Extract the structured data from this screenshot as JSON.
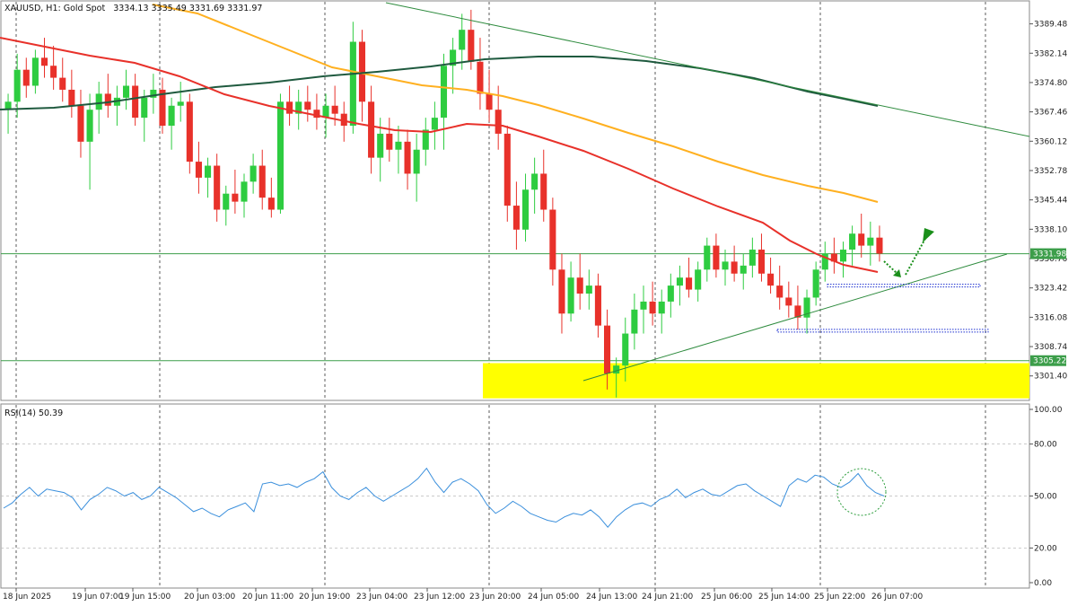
{
  "header": {
    "symbol": "XAUUSD, H1:  Gold Spot",
    "ohlc": "3334.13 3335.49 3331.69 3331.97"
  },
  "rsi": {
    "label": "RSI(14) 50.39",
    "levels": [
      100,
      80,
      50,
      20,
      0
    ],
    "level_labels": [
      "100.00",
      "80.00",
      "50.00",
      "20.00",
      "0.00"
    ]
  },
  "colors": {
    "bull": "#26a69a",
    "bear": "#ef3b2c",
    "bull_candle": "#2ecc40",
    "bear_candle": "#e8312a",
    "ma_fast": "#e8312a",
    "ma_mid": "#ffb020",
    "ma_slow": "#1f5a3f",
    "trend": "#2e8b3e",
    "zone": "#ffff00",
    "rsi_line": "#3a8fdc",
    "level_dotted": "#1b2fd0",
    "arrow": "#1a8f1a"
  },
  "chart_data": {
    "type": "candlestick",
    "title": "XAUUSD, H1:  Gold Spot",
    "ylim": [
      3295.5,
      3395.0
    ],
    "price_ticks": [
      "3389.48",
      "3382.14",
      "3374.80",
      "3367.46",
      "3360.12",
      "3352.78",
      "3345.44",
      "3338.10",
      "3330.76",
      "3323.42",
      "3316.08",
      "3308.74",
      "3301.40"
    ],
    "x_labels": [
      "18 Jun 2025",
      "19 Jun 07:00",
      "19 Jun 15:00",
      "20 Jun 03:00",
      "20 Jun 11:00",
      "20 Jun 19:00",
      "23 Jun 04:00",
      "23 Jun 12:00",
      "23 Jun 20:00",
      "24 Jun 05:00",
      "24 Jun 13:00",
      "24 Jun 21:00",
      "25 Jun 06:00",
      "25 Jun 14:00",
      "25 Jun 22:00",
      "26 Jun 07:00"
    ],
    "current_price": "3331.98",
    "support_price": "3305.22",
    "horizontal_lines": [
      3331.98,
      3305.22
    ],
    "zone": [
      3295.8,
      3304.6
    ],
    "dotted_levels": [
      3324.0,
      3312.7
    ],
    "candles": [
      [
        3368,
        3372,
        3362,
        3370
      ],
      [
        3370,
        3382,
        3366,
        3378
      ],
      [
        3378,
        3381,
        3371,
        3374
      ],
      [
        3374,
        3383,
        3372,
        3381
      ],
      [
        3381,
        3386,
        3376,
        3379
      ],
      [
        3379,
        3384,
        3373,
        3376
      ],
      [
        3376,
        3381,
        3370,
        3373
      ],
      [
        3373,
        3378,
        3366,
        3369
      ],
      [
        3369,
        3373,
        3356,
        3360
      ],
      [
        3360,
        3372,
        3348,
        3368
      ],
      [
        3368,
        3375,
        3362,
        3372
      ],
      [
        3372,
        3377,
        3366,
        3369
      ],
      [
        3369,
        3374,
        3364,
        3371
      ],
      [
        3371,
        3378,
        3368,
        3374
      ],
      [
        3374,
        3377,
        3364,
        3366
      ],
      [
        3366,
        3373,
        3360,
        3371
      ],
      [
        3371,
        3377,
        3367,
        3373
      ],
      [
        3373,
        3376,
        3362,
        3364
      ],
      [
        3364,
        3371,
        3358,
        3369
      ],
      [
        3369,
        3375,
        3365,
        3370
      ],
      [
        3370,
        3372,
        3352,
        3355
      ],
      [
        3355,
        3360,
        3347,
        3351
      ],
      [
        3351,
        3356,
        3346,
        3354
      ],
      [
        3354,
        3357,
        3340,
        3343
      ],
      [
        3343,
        3349,
        3339,
        3347
      ],
      [
        3347,
        3353,
        3342,
        3345
      ],
      [
        3345,
        3352,
        3341,
        3350
      ],
      [
        3350,
        3357,
        3347,
        3354
      ],
      [
        3354,
        3358,
        3343,
        3346
      ],
      [
        3346,
        3351,
        3341,
        3343
      ],
      [
        3343,
        3372,
        3342,
        3370
      ],
      [
        3370,
        3374,
        3364,
        3367
      ],
      [
        3367,
        3373,
        3363,
        3370
      ],
      [
        3370,
        3374,
        3365,
        3368
      ],
      [
        3368,
        3372,
        3363,
        3366
      ],
      [
        3366,
        3372,
        3361,
        3369
      ],
      [
        3369,
        3374,
        3364,
        3367
      ],
      [
        3367,
        3370,
        3360,
        3364
      ],
      [
        3364,
        3390,
        3362,
        3385
      ],
      [
        3385,
        3388,
        3365,
        3370
      ],
      [
        3370,
        3374,
        3352,
        3356
      ],
      [
        3356,
        3366,
        3350,
        3362
      ],
      [
        3362,
        3366,
        3355,
        3358
      ],
      [
        3358,
        3364,
        3352,
        3360
      ],
      [
        3360,
        3363,
        3348,
        3352
      ],
      [
        3352,
        3362,
        3345,
        3358
      ],
      [
        3358,
        3366,
        3354,
        3363
      ],
      [
        3363,
        3370,
        3358,
        3366
      ],
      [
        3366,
        3382,
        3358,
        3379
      ],
      [
        3379,
        3386,
        3372,
        3383
      ],
      [
        3383,
        3392,
        3378,
        3388
      ],
      [
        3388,
        3393,
        3378,
        3380
      ],
      [
        3380,
        3386,
        3368,
        3372
      ],
      [
        3372,
        3378,
        3365,
        3368
      ],
      [
        3368,
        3374,
        3358,
        3362
      ],
      [
        3362,
        3364,
        3340,
        3344
      ],
      [
        3344,
        3350,
        3333,
        3338
      ],
      [
        3338,
        3352,
        3335,
        3348
      ],
      [
        3348,
        3356,
        3342,
        3352
      ],
      [
        3352,
        3358,
        3340,
        3343
      ],
      [
        3343,
        3346,
        3324,
        3328
      ],
      [
        3328,
        3332,
        3312,
        3317
      ],
      [
        3317,
        3330,
        3315,
        3326
      ],
      [
        3326,
        3332,
        3318,
        3322
      ],
      [
        3322,
        3328,
        3318,
        3324
      ],
      [
        3324,
        3327,
        3311,
        3314
      ],
      [
        3314,
        3318,
        3298,
        3302
      ],
      [
        3302,
        3306,
        3296,
        3304
      ],
      [
        3304,
        3316,
        3300,
        3312
      ],
      [
        3312,
        3322,
        3308,
        3318
      ],
      [
        3318,
        3324,
        3312,
        3320
      ],
      [
        3320,
        3325,
        3314,
        3317
      ],
      [
        3317,
        3323,
        3312,
        3320
      ],
      [
        3320,
        3327,
        3316,
        3324
      ],
      [
        3324,
        3329,
        3319,
        3326
      ],
      [
        3326,
        3331,
        3321,
        3323
      ],
      [
        3323,
        3330,
        3320,
        3328
      ],
      [
        3328,
        3336,
        3325,
        3334
      ],
      [
        3334,
        3337,
        3326,
        3328
      ],
      [
        3328,
        3333,
        3324,
        3330
      ],
      [
        3330,
        3334,
        3325,
        3327
      ],
      [
        3327,
        3332,
        3323,
        3329
      ],
      [
        3329,
        3336,
        3326,
        3333
      ],
      [
        3333,
        3337,
        3325,
        3327
      ],
      [
        3327,
        3331,
        3322,
        3324
      ],
      [
        3324,
        3329,
        3318,
        3321
      ],
      [
        3321,
        3325,
        3316,
        3319
      ],
      [
        3319,
        3324,
        3313,
        3316
      ],
      [
        3316,
        3323,
        3312,
        3321
      ],
      [
        3321,
        3330,
        3319,
        3328
      ],
      [
        3328,
        3335,
        3325,
        3332
      ],
      [
        3332,
        3336,
        3327,
        3330
      ],
      [
        3330,
        3335,
        3326,
        3333
      ],
      [
        3333,
        3339,
        3329,
        3337
      ],
      [
        3337,
        3342,
        3331,
        3334
      ],
      [
        3334,
        3340,
        3329,
        3336
      ],
      [
        3336,
        3339,
        3330,
        3332
      ]
    ],
    "ma_fast": [
      3387,
      3385,
      3383,
      3381,
      3378,
      3375,
      3373,
      3370,
      3367,
      3365,
      3363,
      3362,
      3360,
      3358,
      3356,
      3354,
      3352,
      3350,
      3347,
      3345,
      3343,
      3341,
      3339,
      3337,
      3335,
      3333,
      3331,
      3329,
      3327,
      3326,
      3325,
      3324,
      3327
    ],
    "ma_mid_points": [
      [
        170,
        5
      ],
      [
        220,
        15
      ],
      [
        270,
        35
      ],
      [
        320,
        55
      ],
      [
        370,
        75
      ],
      [
        420,
        85
      ],
      [
        470,
        95
      ],
      [
        520,
        100
      ],
      [
        560,
        107
      ],
      [
        600,
        117
      ],
      [
        650,
        132
      ],
      [
        700,
        148
      ],
      [
        750,
        163
      ],
      [
        800,
        180
      ],
      [
        850,
        195
      ],
      [
        900,
        207
      ],
      [
        940,
        215
      ],
      [
        978,
        225
      ]
    ],
    "ma_slow_points": [
      [
        0,
        122
      ],
      [
        60,
        120
      ],
      [
        120,
        114
      ],
      [
        180,
        105
      ],
      [
        240,
        97
      ],
      [
        300,
        92
      ],
      [
        360,
        85
      ],
      [
        420,
        80
      ],
      [
        480,
        74
      ],
      [
        540,
        66
      ],
      [
        600,
        63
      ],
      [
        660,
        63
      ],
      [
        720,
        68
      ],
      [
        780,
        76
      ],
      [
        840,
        87
      ],
      [
        900,
        102
      ],
      [
        940,
        110
      ],
      [
        978,
        118
      ]
    ],
    "ma_fast_points": [
      [
        0,
        42
      ],
      [
        50,
        52
      ],
      [
        100,
        62
      ],
      [
        150,
        70
      ],
      [
        200,
        85
      ],
      [
        250,
        105
      ],
      [
        300,
        118
      ],
      [
        350,
        128
      ],
      [
        400,
        138
      ],
      [
        440,
        145
      ],
      [
        480,
        147
      ],
      [
        520,
        138
      ],
      [
        560,
        140
      ],
      [
        600,
        152
      ],
      [
        650,
        168
      ],
      [
        700,
        188
      ],
      [
        750,
        210
      ],
      [
        800,
        230
      ],
      [
        850,
        248
      ],
      [
        880,
        268
      ],
      [
        910,
        283
      ],
      [
        940,
        295
      ],
      [
        978,
        303
      ]
    ],
    "trend_lines": [
      [
        [
          430,
          3
        ],
        [
          1147,
          152
        ]
      ],
      [
        [
          650,
          424
        ],
        [
          1122,
          283
        ]
      ]
    ],
    "rsi_values": [
      43,
      46,
      51,
      55,
      50,
      54,
      53,
      52,
      49,
      42,
      48,
      51,
      55,
      53,
      50,
      52,
      48,
      50,
      55,
      52,
      49,
      45,
      41,
      43,
      40,
      38,
      42,
      44,
      46,
      41,
      57,
      58,
      56,
      57,
      55,
      58,
      60,
      64,
      55,
      50,
      48,
      52,
      55,
      50,
      47,
      50,
      53,
      56,
      60,
      66,
      58,
      52,
      58,
      60,
      57,
      53,
      45,
      40,
      43,
      47,
      44,
      40,
      38,
      36,
      35,
      38,
      40,
      39,
      42,
      38,
      32,
      38,
      42,
      45,
      46,
      44,
      48,
      50,
      54,
      49,
      52,
      54,
      51,
      50,
      53,
      56,
      57,
      53,
      50,
      47,
      44,
      56,
      60,
      58,
      62,
      61,
      57,
      55,
      58,
      63,
      56,
      52,
      50
    ]
  },
  "annotations": {
    "arrow_down": "dotted-arrow-down",
    "arrow_up": "dotted-arrow-up",
    "rsi_circle": "dotted-circle"
  }
}
